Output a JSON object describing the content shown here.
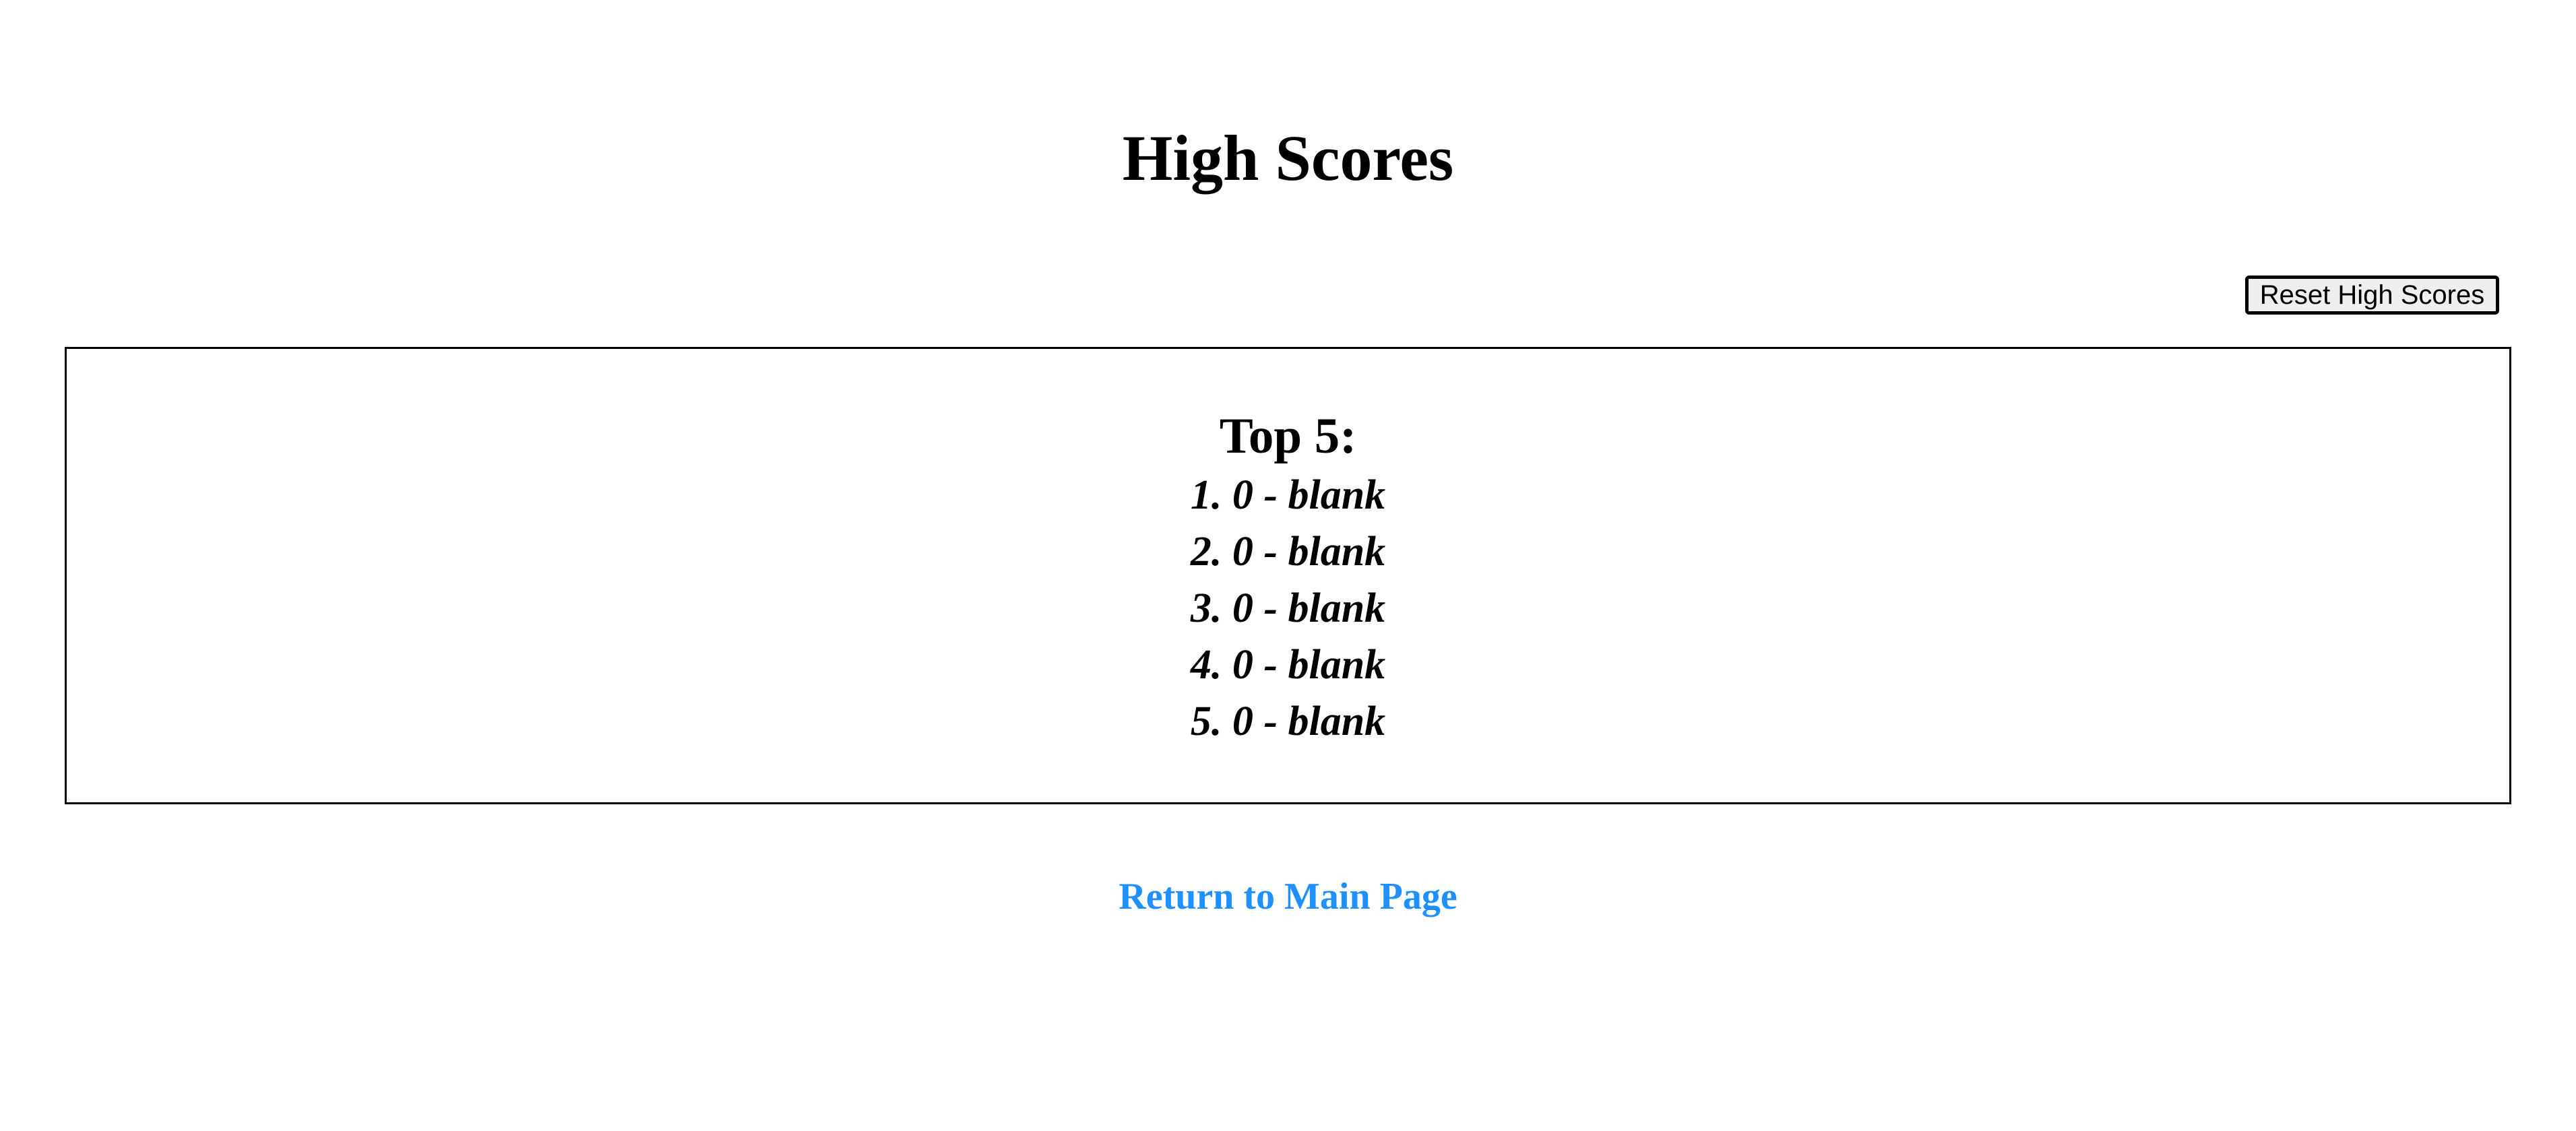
{
  "page": {
    "title": "High Scores"
  },
  "controls": {
    "reset_label": "Reset High Scores"
  },
  "scores": {
    "heading": "Top 5:",
    "entries": [
      {
        "rank": "1.",
        "score": "0",
        "separator": "-",
        "name": "blank"
      },
      {
        "rank": "2.",
        "score": "0",
        "separator": "-",
        "name": "blank"
      },
      {
        "rank": "3.",
        "score": "0",
        "separator": "-",
        "name": "blank"
      },
      {
        "rank": "4.",
        "score": "0",
        "separator": "-",
        "name": "blank"
      },
      {
        "rank": "5.",
        "score": "0",
        "separator": "-",
        "name": "blank"
      }
    ]
  },
  "footer": {
    "return_label": "Return to Main Page"
  },
  "colors": {
    "link": "#1e90ff",
    "text": "#000000",
    "button_background": "#efefef"
  }
}
